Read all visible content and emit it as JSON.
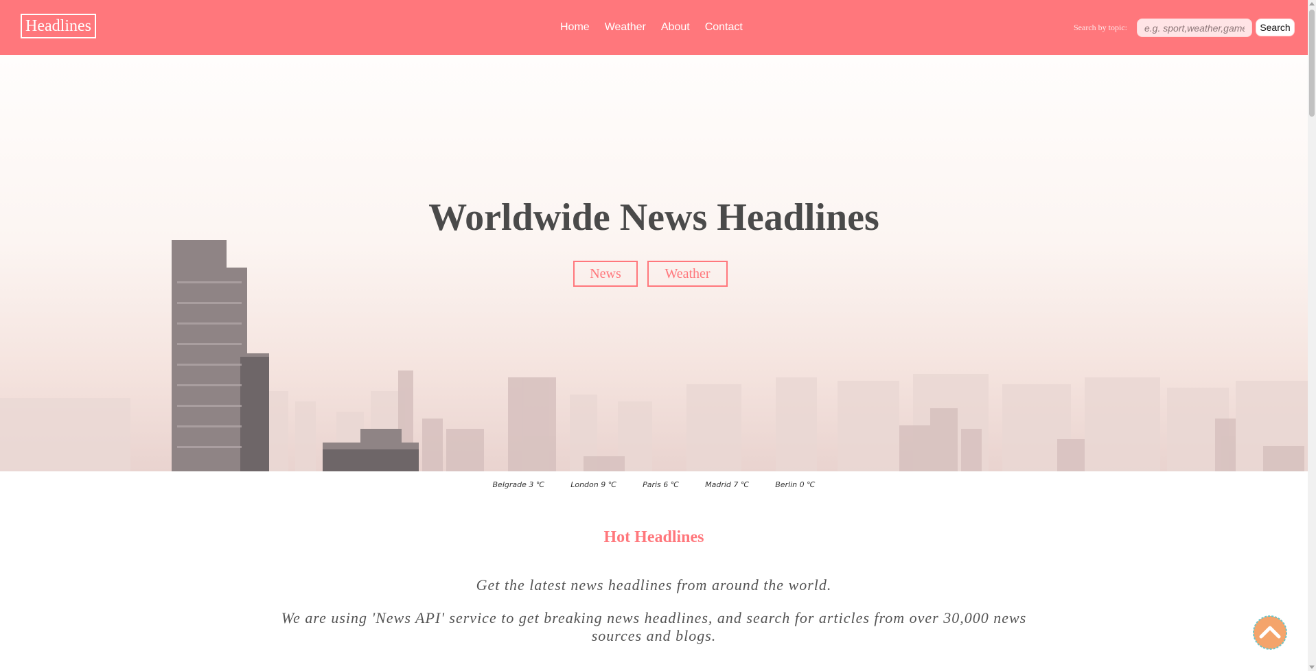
{
  "nav": {
    "brand": "Headlines",
    "links": [
      "Home",
      "Weather",
      "About",
      "Contact"
    ],
    "search_label": "Search by topic:",
    "search_placeholder": "e.g. sport,weather,games",
    "search_button": "Search"
  },
  "hero": {
    "title": "Worldwide News Headlines",
    "buttons": [
      "News",
      "Weather"
    ]
  },
  "weather": [
    "Belgrade 3 ℃",
    "London 9 ℃",
    "Paris 6 ℃",
    "Madrid 7 ℃",
    "Berlin 0 ℃"
  ],
  "headlines": {
    "title": "Hot Headlines",
    "intro": [
      "Get the latest news headlines from around the world.",
      "We are using 'News API' service to get breaking news headlines, and search for articles from over 30,000 news sources and blogs."
    ]
  },
  "colors": {
    "accent": "#ff777c",
    "back_to_top": "#f4a46b"
  },
  "icons": {
    "back_to_top": "chevron-up-icon"
  }
}
